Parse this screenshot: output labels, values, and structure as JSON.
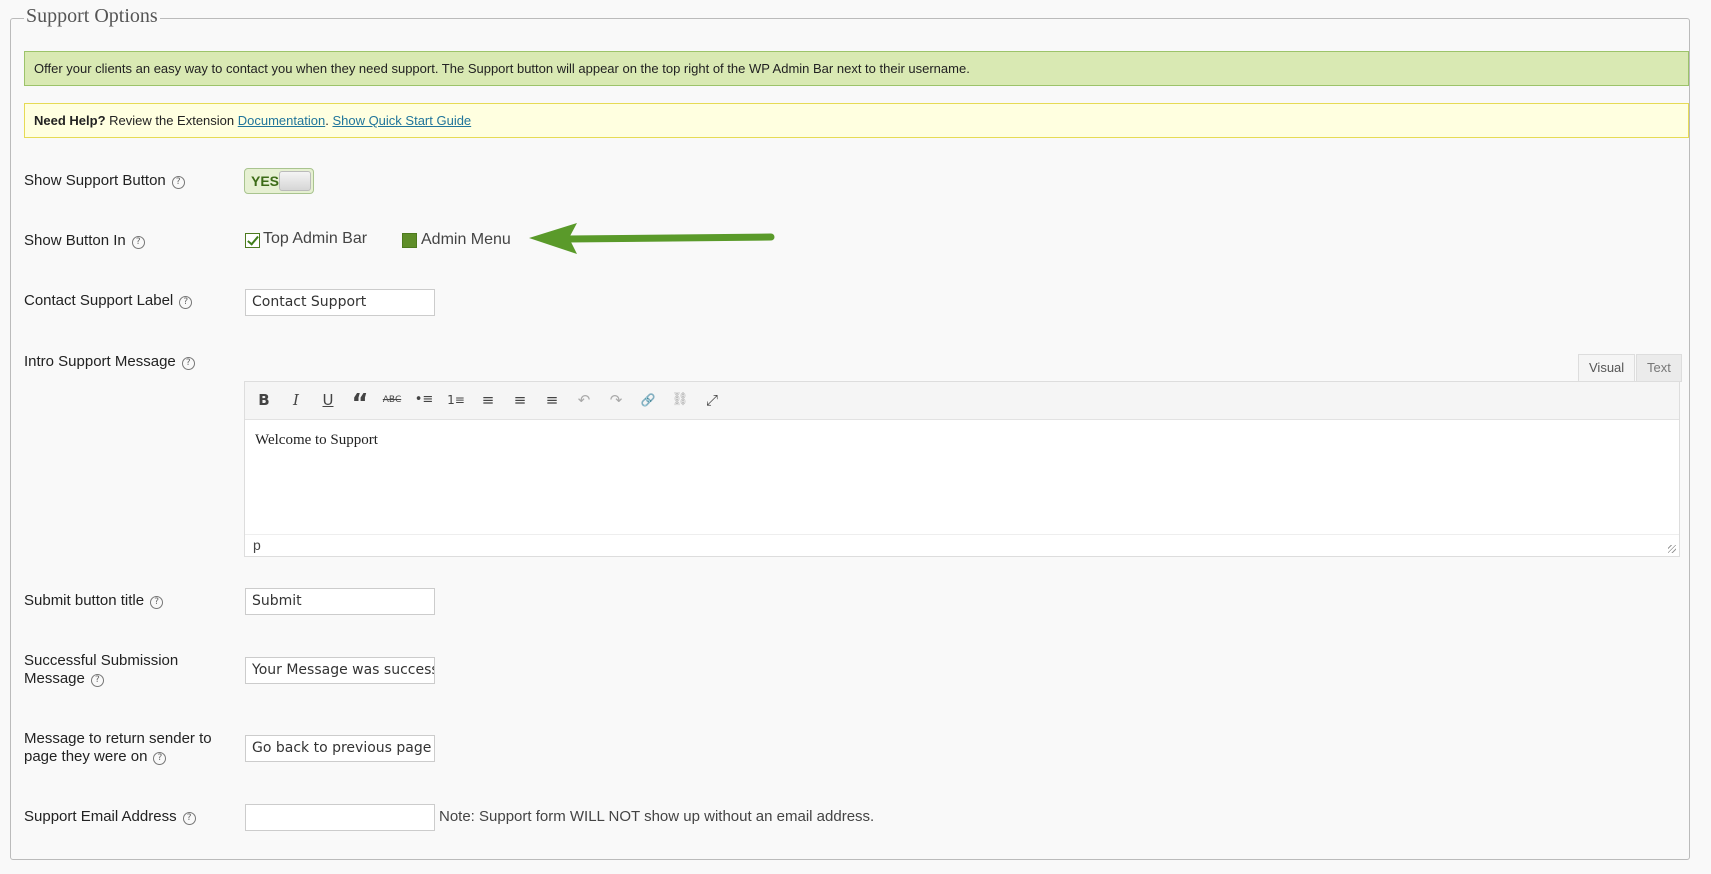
{
  "section": {
    "legend": "Support Options"
  },
  "notices": {
    "info": "Offer your clients an easy way to contact you when they need support. The Support button will appear on the top right of the WP Admin Bar next to their username.",
    "help_bold": "Need Help?",
    "help_text": " Review the Extension ",
    "help_link_docs": "Documentation",
    "help_sep": ". ",
    "help_link_guide": "Show Quick Start Guide"
  },
  "fields": {
    "show_support_button": {
      "label": "Show Support Button",
      "toggle_text": "YES",
      "enabled": true
    },
    "show_button_in": {
      "label": "Show Button In",
      "options": [
        {
          "label": "Top Admin Bar",
          "checked": true
        },
        {
          "label": "Admin Menu",
          "checked": false
        }
      ]
    },
    "contact_support_label": {
      "label": "Contact Support Label",
      "value": "Contact Support"
    },
    "intro_support_message": {
      "label": "Intro Support Message",
      "tabs": [
        "Visual",
        "Text"
      ],
      "active_tab": "Visual",
      "content": "Welcome to Support",
      "status_path": "p",
      "toolbar": [
        "B",
        "I",
        "U",
        "“",
        "ABC",
        "•≡",
        "1≡",
        "≡",
        "≡",
        "≡",
        "↶",
        "↷",
        "🔗",
        "⛓",
        "⤢"
      ]
    },
    "submit_button_title": {
      "label": "Submit button title",
      "value": "Submit"
    },
    "successful_submission_message": {
      "label_line1": "Successful Submission",
      "label_line2": "Message",
      "value": "Your Message was successful"
    },
    "return_message": {
      "label_line1": "Message to return sender to",
      "label_line2": "page they were on",
      "value": "Go back to previous page ("
    },
    "support_email": {
      "label": "Support Email Address",
      "value": "",
      "note": "Note: Support form WILL NOT show up without an email address."
    }
  },
  "colors": {
    "info_bg": "#d9e9b3",
    "help_bg": "#ffffe0",
    "arrow": "#5a9a2a"
  }
}
